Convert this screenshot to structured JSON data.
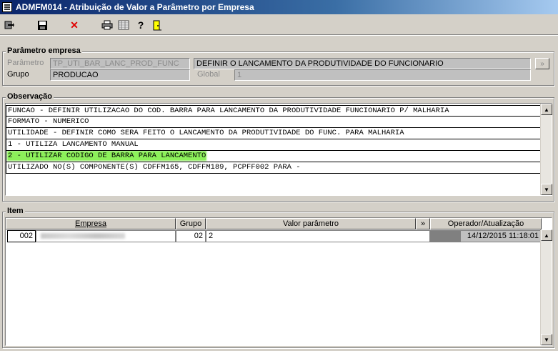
{
  "window": {
    "title": "ADMFM014 - Atribuição de Valor a Parâmetro por Empresa"
  },
  "toolbar": {
    "icons": [
      "exit-icon",
      "save-icon",
      "delete-icon",
      "print-icon",
      "grid-icon",
      "help-icon",
      "door-icon"
    ]
  },
  "parametro_empresa": {
    "group_label": "Parâmetro empresa",
    "parametro_label": "Parâmetro",
    "parametro_value": "TP_UTI_BAR_LANC_PROD_FUNC",
    "descricao_value": "DEFINIR  O LANCAMENTO DA PRODUTIVIDADE DO FUNCIONARIO",
    "expand_button": "»",
    "grupo_label": "Grupo",
    "grupo_value": "PRODUCAO",
    "global_label": "Global",
    "global_value": "1"
  },
  "observacao": {
    "group_label": "Observação",
    "lines": [
      "FUNCAO - DEFINIR UTILIZACAO DO COD. BARRA PARA LANCAMENTO DA PRODUTIVIDADE FUNCIONARIO P/  MALHARIA",
      "FORMATO - NUMERICO",
      "UTILIDADE - DEFINIR COMO SERA FEITO O LANCAMENTO DA PRODUTIVIDADE DO FUNC. PARA MALHARIA",
      "1 - UTILIZA LANCAMENTO MANUAL",
      "2 - UTILIZAR CODIGO DE BARRA PARA LANCAMENTO",
      "UTILIZADO NO(S) COMPONENTE(S) CDFFM165, CDFFM189,  PCPFF002 PARA  -"
    ],
    "highlighted_line_index": 4
  },
  "item": {
    "group_label": "Item",
    "columns": {
      "empresa": "Empresa",
      "grupo": "Grupo",
      "valor": "Valor parâmetro",
      "expand": "»",
      "operador": "Operador/Atualização"
    },
    "rows": [
      {
        "empresa_code": "002",
        "grupo": "02",
        "valor": "2",
        "atualizacao": "14/12/2015 11:18:01"
      }
    ]
  },
  "colors": {
    "highlight": "#8cf05a",
    "title_bar": "#0a246a",
    "delete_icon": "#e00000"
  }
}
